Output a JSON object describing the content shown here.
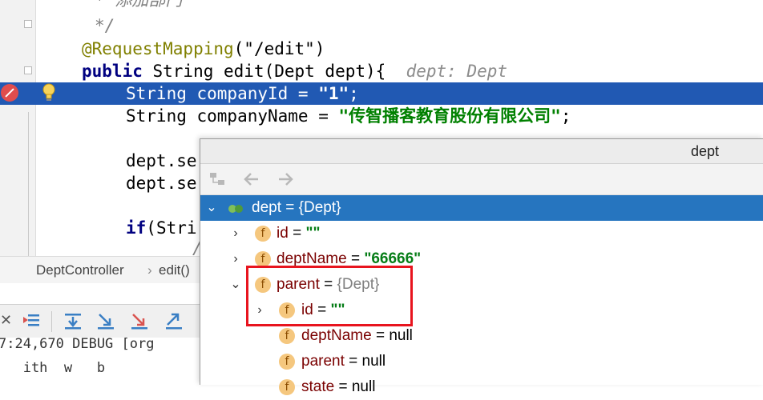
{
  "editor": {
    "lines": {
      "comment1": "* 添加部门",
      "comment2": "*/",
      "annotation": "@RequestMapping",
      "annotation_arg": "(\"/edit\")",
      "sig_kw": "public",
      "sig_rest": " String edit(Dept dept){",
      "sig_hint": "dept: Dept",
      "line_company_id_a": "String companyId = ",
      "line_company_id_str": "\"1\"",
      "line_company_id_end": ";",
      "line_company_name_a": "String companyName = ",
      "line_company_name_str": "\"传智播客教育股份有限公司\"",
      "line_company_name_end": ";",
      "dept_set1": "dept.se",
      "dept_set2": "dept.se",
      "if_kw": "if",
      "if_rest": "(Stri",
      "comment_slash": "//;"
    }
  },
  "breadcrumb": {
    "class": "DeptController",
    "sep": "›",
    "method": "edit()"
  },
  "console": {
    "line1": "7:24,670 DEBUG [org",
    "line2": "   ith  w   b"
  },
  "popup": {
    "title": "dept",
    "tree": [
      {
        "name": "dept",
        "eq": " = ",
        "value": "{Dept}"
      },
      {
        "name": "id",
        "eq": " = ",
        "value": "\"\""
      },
      {
        "name": "deptName",
        "eq": " = ",
        "value": "\"66666\""
      },
      {
        "name": "parent",
        "eq": " = ",
        "value": "{Dept}"
      },
      {
        "name": "id",
        "eq": " = ",
        "value": "\"\""
      },
      {
        "name": "deptName",
        "eq": " = ",
        "value": "null"
      },
      {
        "name": "parent",
        "eq": " = ",
        "value": "null"
      },
      {
        "name": "state",
        "eq": " = ",
        "value": "null"
      }
    ]
  },
  "colors": {
    "selection": "#2159b3",
    "tree_selection": "#2675bf",
    "highlight_box": "#e8141e",
    "string": "#008000",
    "keyword": "#000080"
  },
  "icons": {
    "breakpoint": "breakpoint-icon",
    "bulb": "lightbulb-icon",
    "field_badge": "f"
  }
}
